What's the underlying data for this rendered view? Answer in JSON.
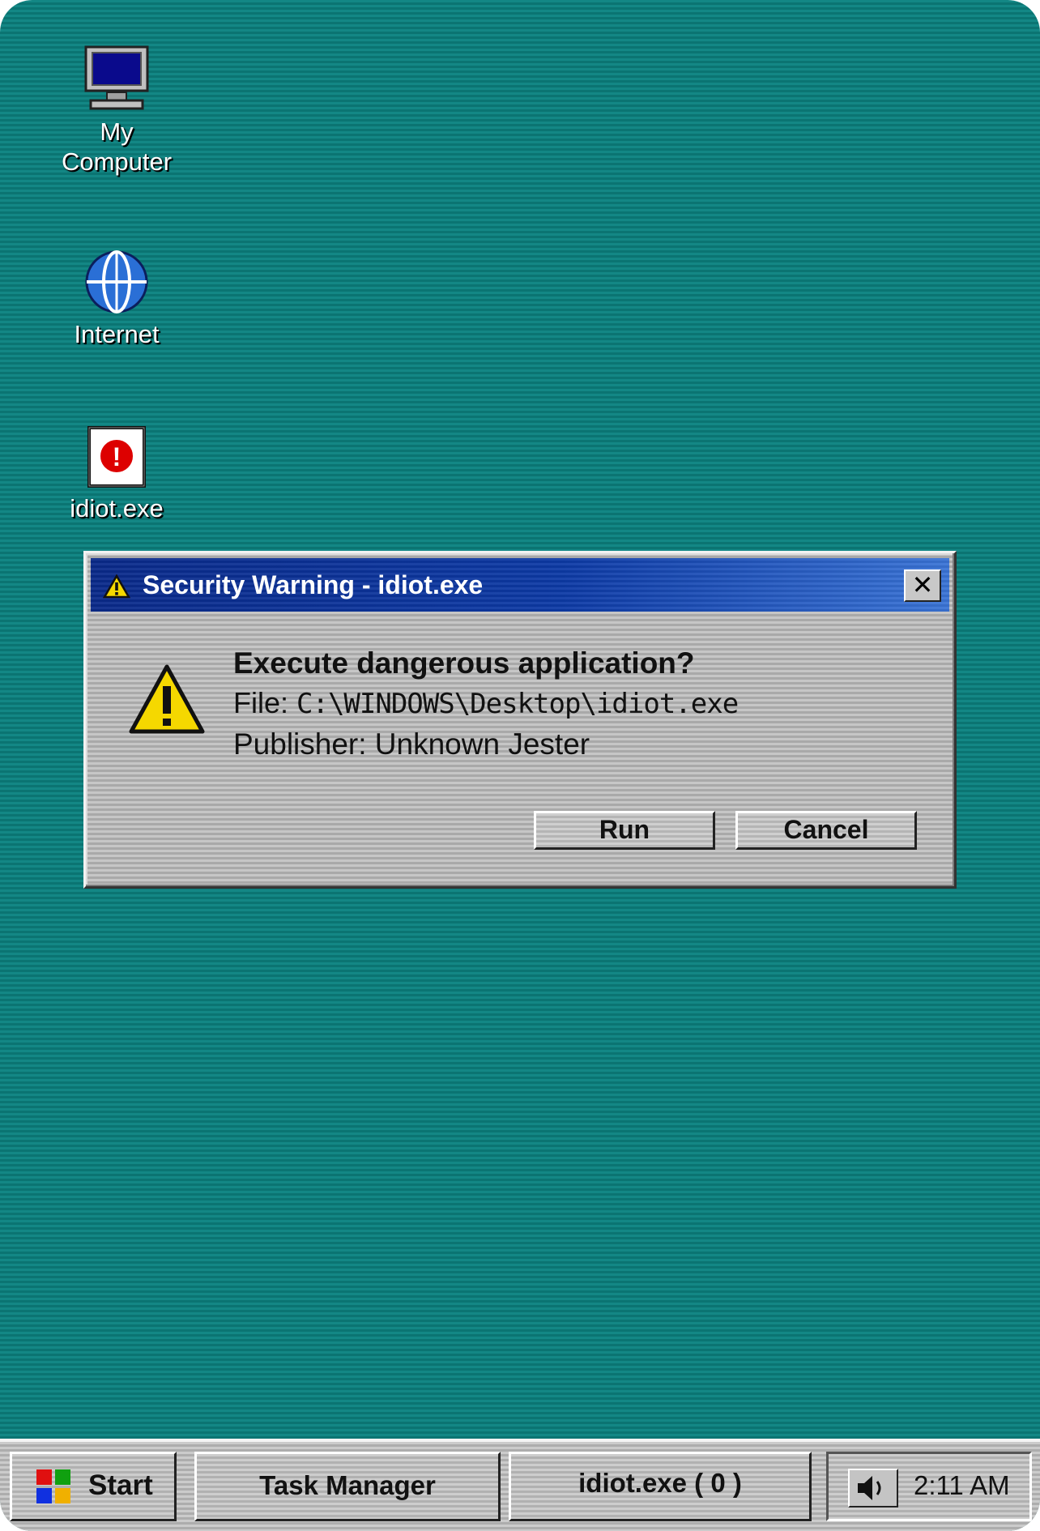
{
  "desktop": {
    "icons": [
      {
        "label_line1": "My",
        "label_line2": "Computer",
        "icon": "computer-icon"
      },
      {
        "label": "Internet",
        "icon": "globe-icon"
      },
      {
        "label": "idiot.exe",
        "icon": "error-icon"
      }
    ]
  },
  "dialog": {
    "title": "Security Warning - idiot.exe",
    "close_symbol": "✕",
    "heading": "Execute dangerous application?",
    "file_label": "File: ",
    "file_path": "C:\\WINDOWS\\Desktop\\idiot.exe",
    "publisher": "Publisher: Unknown Jester",
    "run_label": "Run",
    "cancel_label": "Cancel"
  },
  "taskbar": {
    "start_label": "Start",
    "items": [
      {
        "label": "Task Manager"
      },
      {
        "label": "idiot.exe ( 0 )"
      }
    ],
    "clock": "2:11 AM"
  },
  "colors": {
    "desktop": "#0f7f7c",
    "titlebar_start": "#0a2a8a",
    "titlebar_end": "#3a74d6",
    "warning_yellow": "#f5d800",
    "error_red": "#dd0000"
  }
}
